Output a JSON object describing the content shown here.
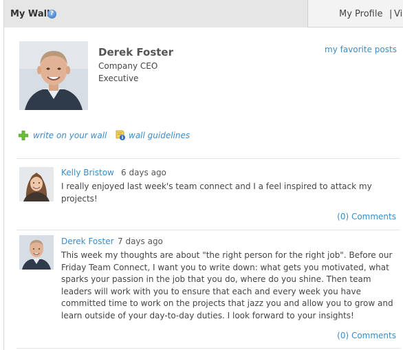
{
  "tabs": {
    "active_label": "My Wall",
    "profile_label": "My Profile",
    "separator": "|",
    "next_label": "View"
  },
  "profile": {
    "name": "Derek Foster",
    "title": "Company CEO",
    "role": "Executive",
    "favorite_link": "my favorite posts"
  },
  "actions": {
    "write_label": "write on your wall",
    "guidelines_label": "wall guidelines"
  },
  "posts": [
    {
      "author": "Kelly Bristow",
      "time": "6 days ago",
      "body": "I really enjoyed last week's team connect and I a feel inspired to attack my projects!",
      "comments": "(0) Comments"
    },
    {
      "author": "Derek Foster",
      "time": "7 days ago",
      "body": "This week my thoughts are about \"the right person for the right job\". Before our Friday Team Connect, I want you to write down: what gets you motivated, what sparks your passion in the job that you do, where do you shine. Then team leaders will work with you to ensure that each and every week you have committed time to work on the projects that jazz you and allow you to grow and learn outside of your day-to-day duties. I look forward to your insights!",
      "comments": "(0) Comments"
    }
  ],
  "icons": {
    "help": "help-icon",
    "add": "plus-icon",
    "guidelines": "guidelines-icon"
  },
  "colors": {
    "link": "#3a8cc6",
    "tab_active_bg": "#e6e6e6",
    "add_icon": "#6cbf3a"
  }
}
